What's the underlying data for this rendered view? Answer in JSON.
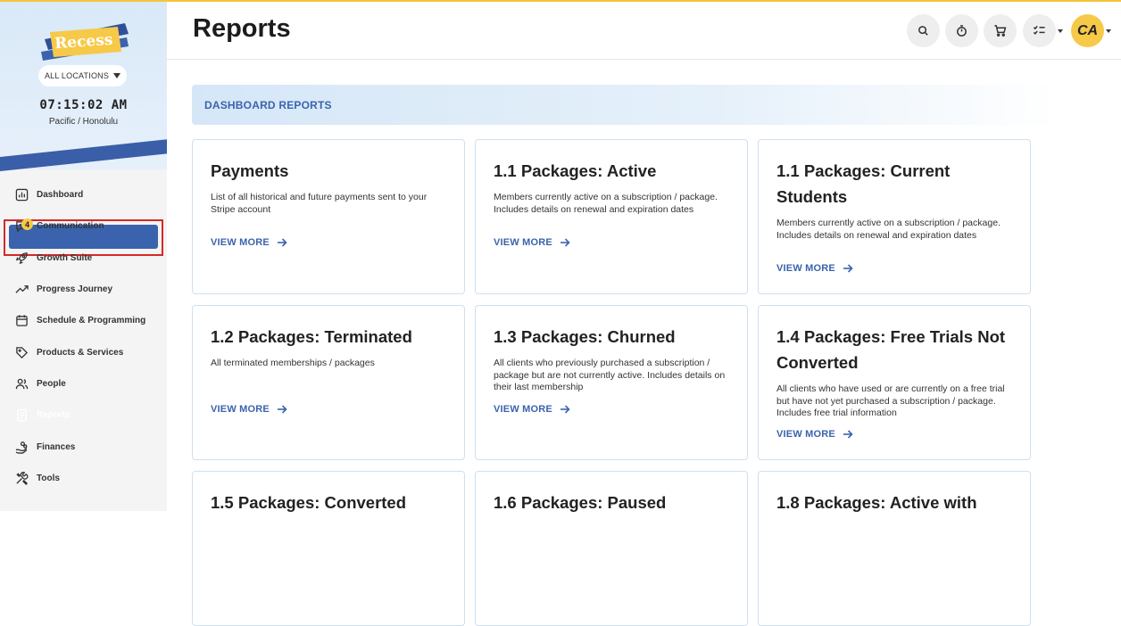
{
  "brand": {
    "logo_text": "Recess",
    "colors": {
      "primary": "#3b63ad",
      "accent": "#f7c948"
    }
  },
  "sidebar": {
    "location_label": "ALL LOCATIONS",
    "clock": "07:15:02 AM",
    "timezone": "Pacific / Honolulu",
    "items": [
      {
        "label": "Dashboard",
        "icon": "bar-chart-icon"
      },
      {
        "label": "Communication",
        "icon": "chat-icon",
        "badge": "4"
      },
      {
        "label": "Growth Suite",
        "icon": "rocket-icon"
      },
      {
        "label": "Progress Journey",
        "icon": "trend-icon"
      },
      {
        "label": "Schedule & Programming",
        "icon": "calendar-icon"
      },
      {
        "label": "Products & Services",
        "icon": "tag-icon"
      },
      {
        "label": "People",
        "icon": "people-icon"
      },
      {
        "label": "Reports",
        "icon": "document-icon",
        "active": true
      },
      {
        "label": "Finances",
        "icon": "hand-coins-icon"
      },
      {
        "label": "Tools",
        "icon": "tools-icon"
      }
    ]
  },
  "header": {
    "title": "Reports",
    "avatar_initials": "CA",
    "buttons": [
      "search-icon",
      "timer-icon",
      "cart-icon",
      "checklist-icon"
    ]
  },
  "main": {
    "section_title": "DASHBOARD REPORTS",
    "cards": [
      {
        "title": "Payments",
        "desc": "List of all historical and future payments sent to your Stripe account",
        "link": "VIEW MORE"
      },
      {
        "title": "1.1 Packages: Active",
        "desc": "Members currently active on a subscription / package. Includes details on renewal and expiration dates",
        "link": "VIEW MORE"
      },
      {
        "title": "1.1 Packages: Current Students",
        "desc": "Members currently active on a subscription / package. Includes details on renewal and expiration dates",
        "link": "VIEW MORE"
      },
      {
        "title": "1.2 Packages: Terminated",
        "desc": "All terminated memberships / packages",
        "link": "VIEW MORE"
      },
      {
        "title": "1.3 Packages: Churned",
        "desc": "All clients who previously purchased a subscription / package but are not currently active. Includes details on their last membership",
        "link": "VIEW MORE"
      },
      {
        "title": "1.4 Packages: Free Trials Not Converted",
        "desc": "All clients who have used or are currently on a free trial but have not yet purchased a subscription / package. Includes free trial information",
        "link": "VIEW MORE"
      },
      {
        "title": "1.5 Packages: Converted",
        "desc": "",
        "link": ""
      },
      {
        "title": "1.6 Packages: Paused",
        "desc": "",
        "link": ""
      },
      {
        "title": "1.8 Packages: Active with",
        "desc": "",
        "link": ""
      }
    ]
  }
}
